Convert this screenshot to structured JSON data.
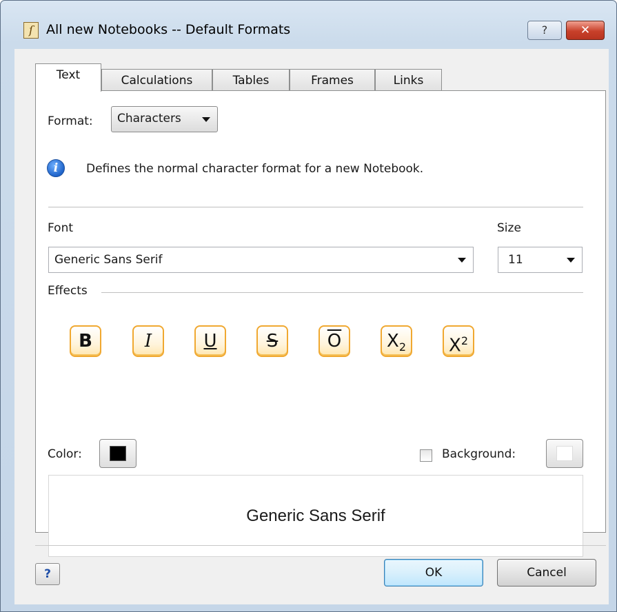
{
  "window": {
    "title": "All new Notebooks -- Default Formats",
    "help_glyph": "?",
    "close_glyph": "✕",
    "app_icon": "notebook-icon"
  },
  "tabs": [
    {
      "label": "Text",
      "active": true
    },
    {
      "label": "Calculations",
      "active": false
    },
    {
      "label": "Tables",
      "active": false
    },
    {
      "label": "Frames",
      "active": false
    },
    {
      "label": "Links",
      "active": false
    }
  ],
  "format": {
    "label": "Format:",
    "selected": "Characters"
  },
  "info": {
    "icon": "info-icon",
    "text": "Defines the normal character format for a new Notebook."
  },
  "font": {
    "label": "Font",
    "value": "Generic Sans Serif"
  },
  "size": {
    "label": "Size",
    "value": "11"
  },
  "effects": {
    "label": "Effects",
    "buttons": [
      {
        "name": "bold",
        "glyph": "B"
      },
      {
        "name": "italic",
        "glyph": "I"
      },
      {
        "name": "underline",
        "glyph": "U"
      },
      {
        "name": "strikethrough",
        "glyph": "S"
      },
      {
        "name": "overline",
        "glyph": "O"
      },
      {
        "name": "subscript",
        "glyph": "X",
        "script": "2"
      },
      {
        "name": "superscript",
        "glyph": "X",
        "script": "2"
      }
    ]
  },
  "color": {
    "label": "Color:",
    "value": "#000000"
  },
  "background": {
    "label": "Background:",
    "checked": false,
    "value": "#ffffff"
  },
  "preview": {
    "text": "Generic Sans Serif"
  },
  "footer": {
    "context_help_glyph": "?",
    "ok_label": "OK",
    "cancel_label": "Cancel"
  }
}
